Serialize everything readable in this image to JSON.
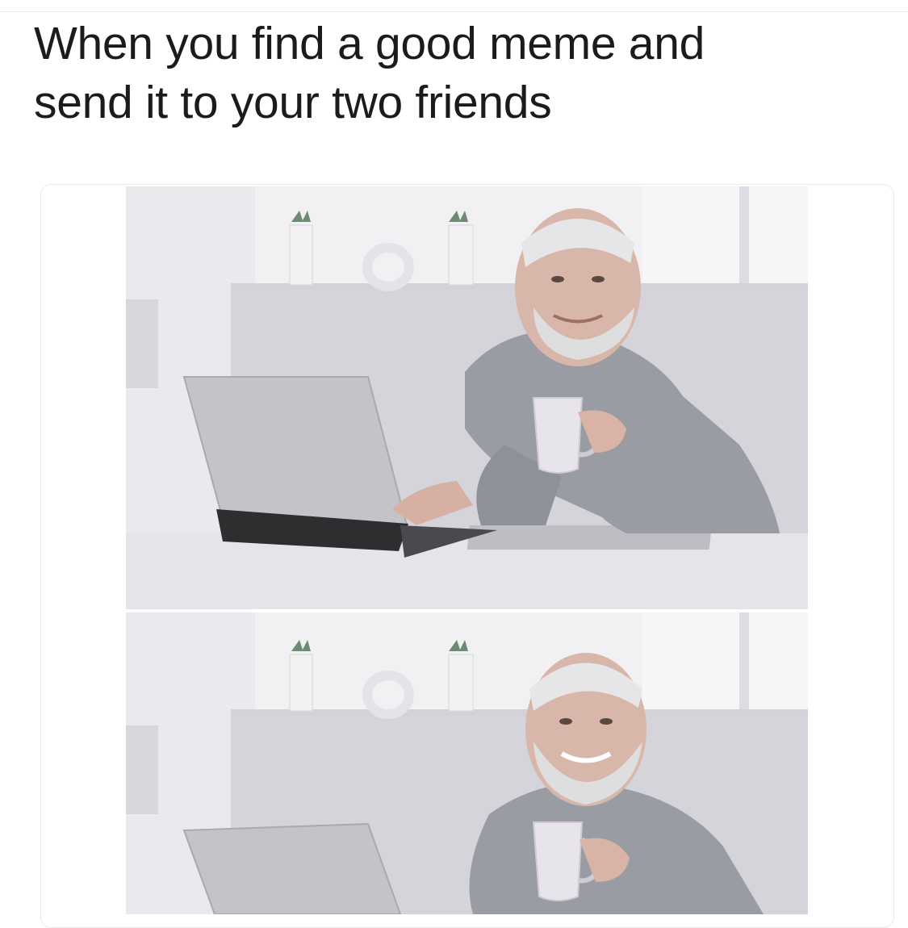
{
  "caption": {
    "text": "When you find a good meme and\nsend it to your two friends"
  },
  "panels": [
    {
      "name": "panel-top",
      "scene": "man-at-laptop-smiling"
    },
    {
      "name": "panel-bottom",
      "scene": "man-pained-smile"
    }
  ],
  "colors": {
    "caption_text": "#1b1b1b",
    "wall": "#ececf0",
    "shelf": "#c9c9cf",
    "shirt": "#9a9ca3",
    "skin": "#d8b3a6",
    "beard": "#dcdcdc",
    "laptop": "#c2c2c6",
    "laptop_base": "#2b2b2e",
    "desk": "#e3e3e7",
    "mug": "#e7e3ea"
  }
}
